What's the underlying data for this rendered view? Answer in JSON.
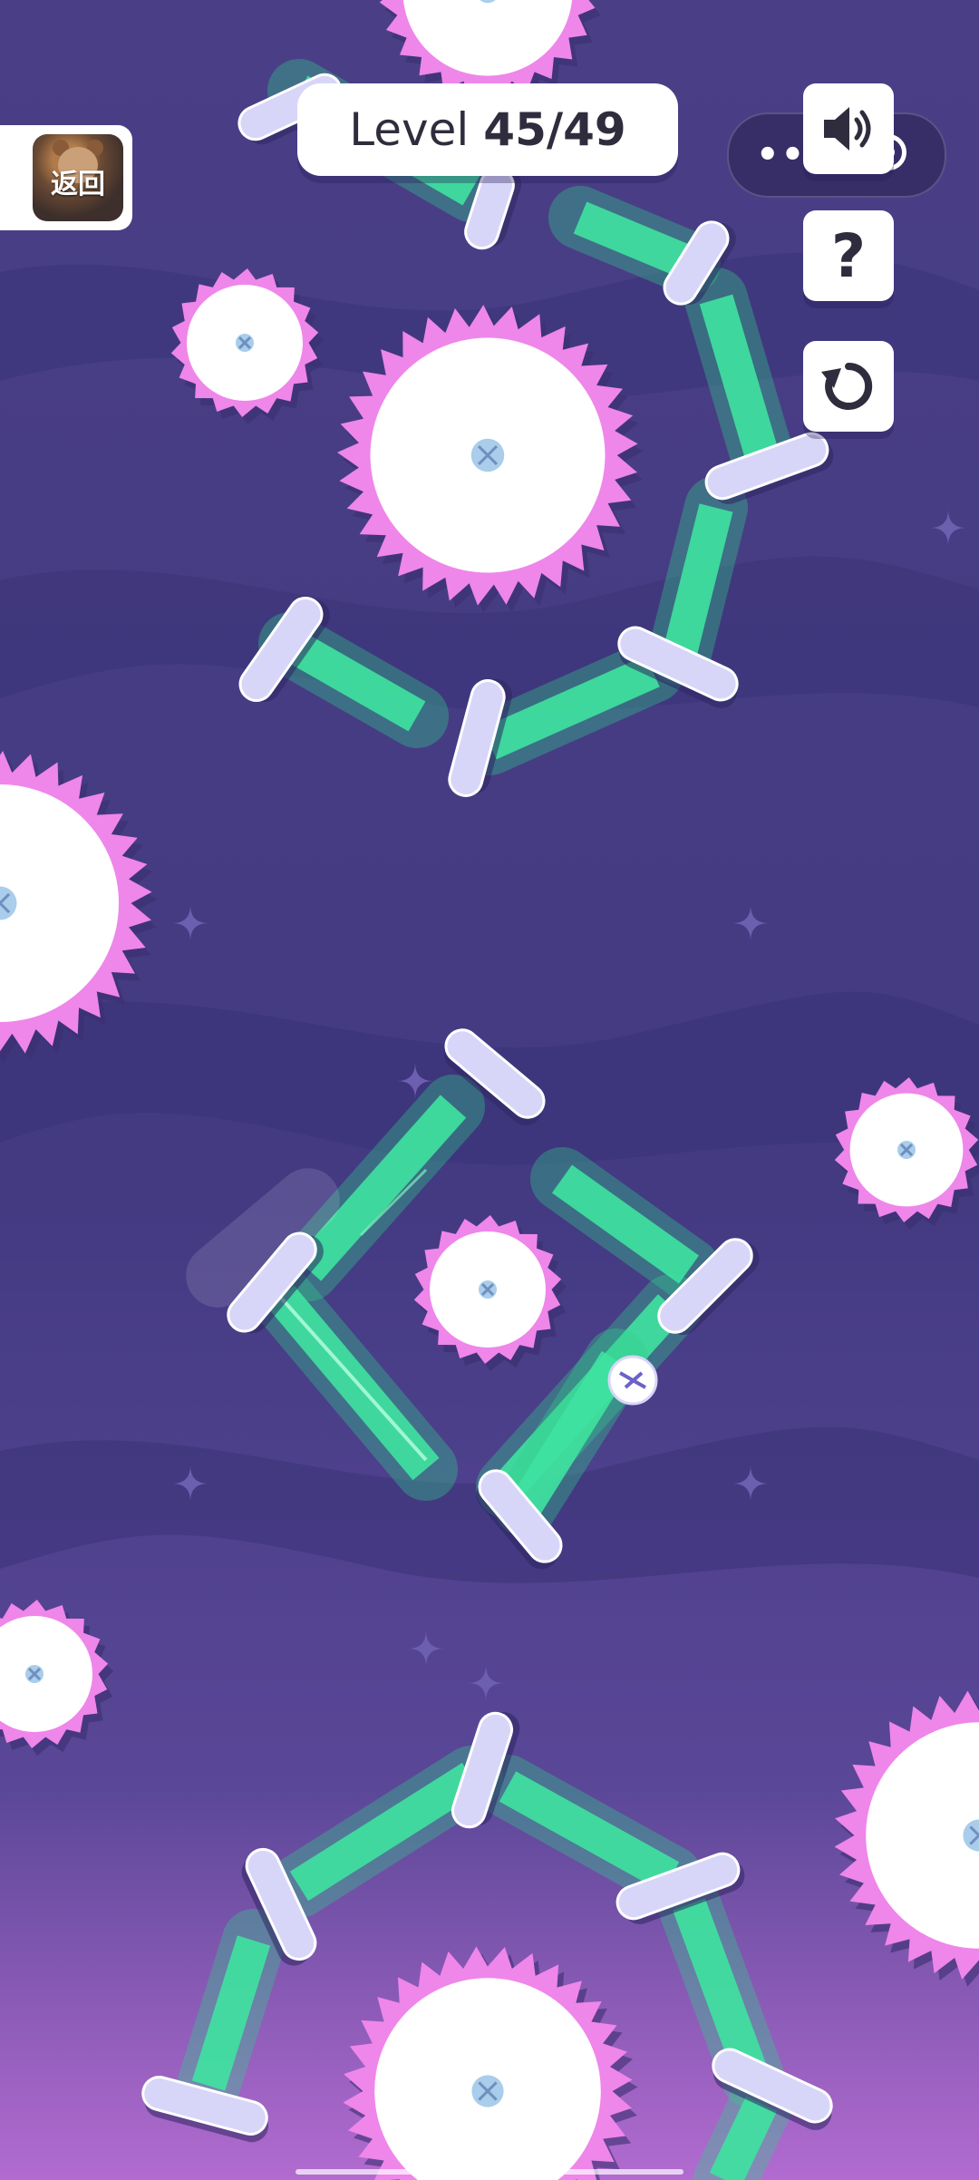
{
  "hud": {
    "level_label": "Level",
    "level_value": "45/49",
    "back_label": "返回",
    "capsule_dots": "•••",
    "help_label": "?",
    "restart_icon": "restart-icon",
    "sound_icon": "speaker-on-icon"
  },
  "colors": {
    "bg_top": "#4a3f86",
    "bg_mid": "#3d3779",
    "bg_bottom": "#a765c9",
    "saw_pink": "#ef86ea",
    "saw_center": "#ffffff",
    "plank": "#d8d6f8",
    "beam_green": "#3fe3a0"
  }
}
